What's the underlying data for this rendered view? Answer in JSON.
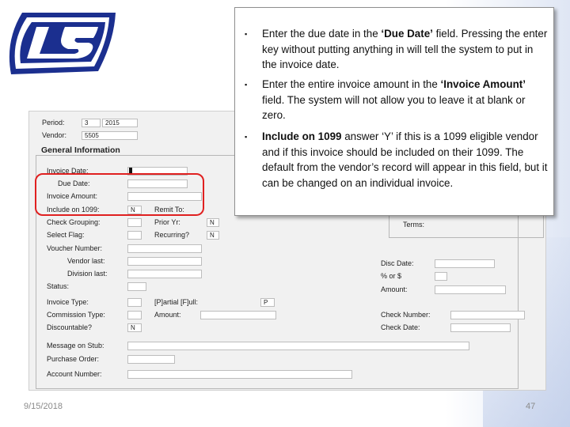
{
  "brand": {
    "accent": "#1b2f8f",
    "highlight": "#e02020"
  },
  "form": {
    "period_label": "Period:",
    "period_value": "3",
    "year_value": "2015",
    "vendor_label": "Vendor:",
    "vendor_value": "5505",
    "section_title": "General Information",
    "invoice_date_label": "Invoice Date:",
    "due_date_label": "Due Date:",
    "invoice_amount_label": "Invoice Amount:",
    "include_1099_label": "Include on 1099:",
    "include_1099_value": "N",
    "remit_to_label": "Remit To:",
    "check_grouping_label": "Check Grouping:",
    "prior_yr_label": "Prior Yr:",
    "prior_yr_value": "N",
    "select_flag_label": "Select Flag:",
    "recurring_label": "Recurring?",
    "recurring_value": "N",
    "voucher_number_label": "Voucher Number:",
    "vendor_last_label": "Vendor last:",
    "division_last_label": "Division last:",
    "status_label": "Status:",
    "invoice_type_label": "Invoice Type:",
    "partial_full_label": "[P]artial [F]ull:",
    "partial_full_value": "P",
    "commission_type_label": "Commission Type:",
    "amount_label": "Amount:",
    "discountable_label": "Discountable?",
    "discountable_value": "N",
    "message_on_stub_label": "Message on Stub:",
    "purchase_order_label": "Purchase Order:",
    "account_number_label": "Account Number:",
    "terms_label": "Terms:",
    "disc_date_label": "Disc Date:",
    "pct_or_s_label": "% or $",
    "right_amount_label": "Amount:",
    "check_number_label": "Check Number:",
    "check_date_label": "Check Date:"
  },
  "callout": {
    "bullet_char": "▪",
    "b1_before": "Enter the due date in the ",
    "b1_bold": "‘Due Date’",
    "b1_after": " field. Pressing the enter key without putting anything in will tell the system to put in the invoice date.",
    "b2_before": "Enter the entire invoice amount in the ",
    "b2_bold": "‘Invoice Amount’",
    "b2_after": " field.  The system will not allow you to leave it at blank or zero.",
    "b3_bold": "Include on 1099",
    "b3_after": " answer ‘Y’ if this is a 1099 eligible vendor and if this invoice should be included on their 1099.  The default from the vendor’s record will appear in this field, but it can be changed on an individual invoice."
  },
  "footer": {
    "date": "9/15/2018",
    "page": "47"
  }
}
